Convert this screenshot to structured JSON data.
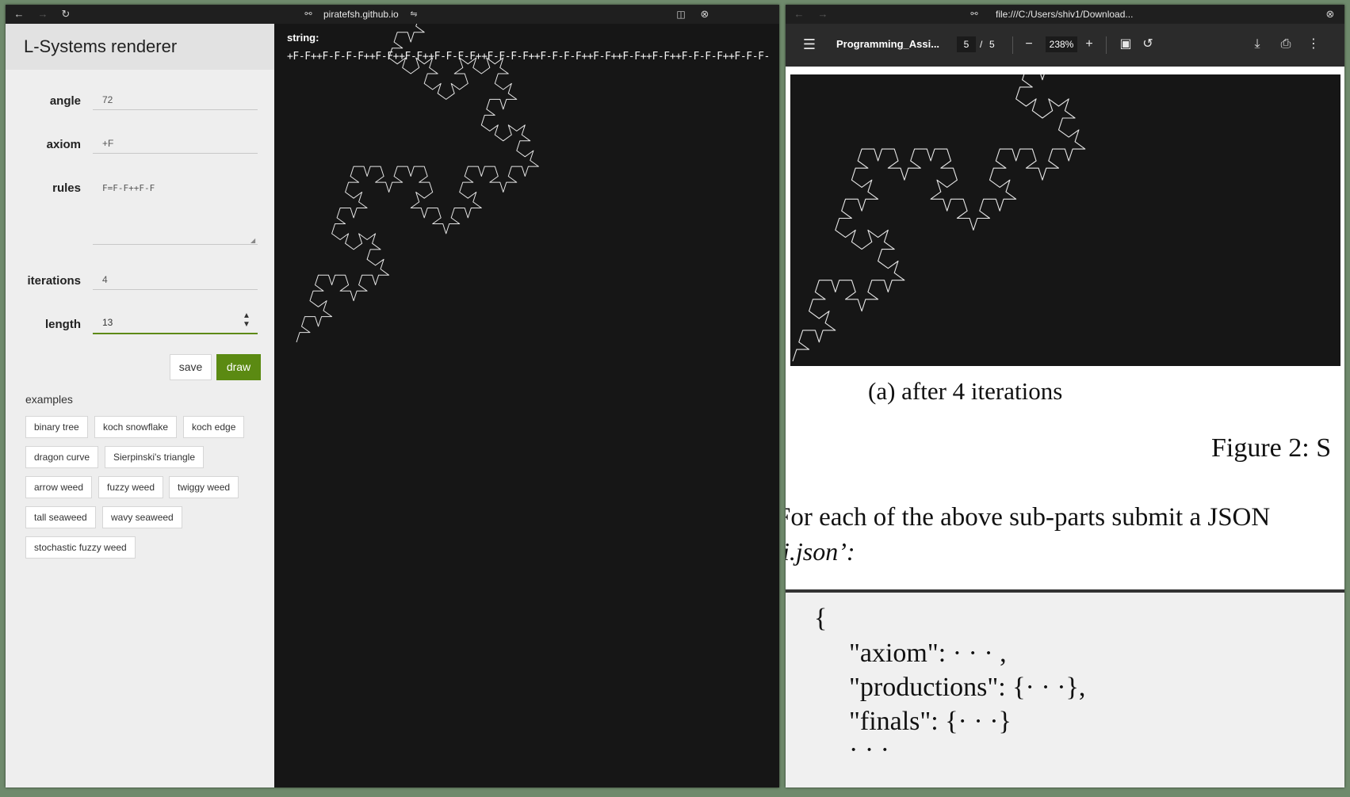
{
  "left_window": {
    "url": "piratefsh.github.io",
    "app_title": "L-Systems renderer",
    "form": {
      "angle_label": "angle",
      "angle_value": "72",
      "axiom_label": "axiom",
      "axiom_value": "+F",
      "rules_label": "rules",
      "rules_value": "F=F-F++F-F",
      "iterations_label": "iterations",
      "iterations_value": "4",
      "length_label": "length",
      "length_value": "13"
    },
    "save_label": "save",
    "draw_label": "draw",
    "examples_label": "examples",
    "examples": [
      "binary tree",
      "koch snowflake",
      "koch edge",
      "dragon curve",
      "Sierpinski's triangle",
      "arrow weed",
      "fuzzy weed",
      "twiggy weed",
      "tall seaweed",
      "wavy seaweed",
      "stochastic fuzzy weed"
    ],
    "string_label": "string:",
    "string_value": "+F-F++F-F-F-F++F-F++F-F++F-F-F-F++F-F-F-F++F-F-F-F++F-F++F-F++F-F++F-F-F-F++F-F-F-F++F-F-F-F++F-F++F-F++F-F++F-F-F-F++F-F-F-F++F-F-F-F++F-F"
  },
  "right_window": {
    "url": "file:///C:/Users/shiv1/Download...",
    "doc_title": "Programming_Assi...",
    "page_current": "5",
    "page_sep": "/",
    "page_total": "5",
    "zoom": "238%",
    "caption": "(a) after 4 iterations",
    "figure_title": "Figure 2:  S",
    "para_line1": "For each of the above sub-parts submit a JSON",
    "para_line2": "i.json’:",
    "code_lines": [
      "{",
      "\"axiom\": · · · ,",
      "\"productions\": {· · ·},",
      "\"finals\": {· · ·}",
      "· · ·"
    ]
  },
  "colors": {
    "draw_button": "#5b8a12",
    "canvas_bg": "#161616",
    "stroke": "#e6e6e6"
  }
}
